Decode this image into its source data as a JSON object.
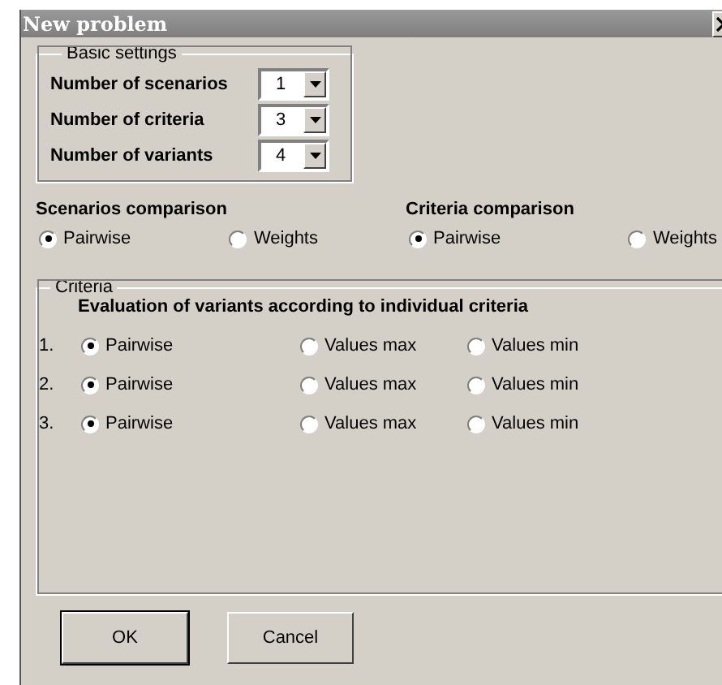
{
  "window": {
    "title": "New problem"
  },
  "basic_settings": {
    "legend": "Basic settings",
    "fields": [
      {
        "label": "Number of scenarios",
        "value": "1"
      },
      {
        "label": "Number of criteria",
        "value": "3"
      },
      {
        "label": "Number of variants",
        "value": "4"
      }
    ]
  },
  "comparisons": [
    {
      "title": "Scenarios comparison",
      "options": [
        {
          "label": "Pairwise",
          "selected": true
        },
        {
          "label": "Weights",
          "selected": false
        }
      ]
    },
    {
      "title": "Criteria comparison",
      "options": [
        {
          "label": "Pairwise",
          "selected": true
        },
        {
          "label": "Weights",
          "selected": false
        }
      ]
    }
  ],
  "criteria": {
    "legend": "Criteria",
    "heading": "Evaluation of variants according to individual criteria",
    "rows": [
      {
        "number": "1.",
        "options": [
          {
            "label": "Pairwise",
            "selected": true
          },
          {
            "label": "Values max",
            "selected": false
          },
          {
            "label": "Values min",
            "selected": false
          }
        ]
      },
      {
        "number": "2.",
        "options": [
          {
            "label": "Pairwise",
            "selected": true
          },
          {
            "label": "Values max",
            "selected": false
          },
          {
            "label": "Values min",
            "selected": false
          }
        ]
      },
      {
        "number": "3.",
        "options": [
          {
            "label": "Pairwise",
            "selected": true
          },
          {
            "label": "Values max",
            "selected": false
          },
          {
            "label": "Values min",
            "selected": false
          }
        ]
      }
    ]
  },
  "buttons": [
    {
      "label": "OK",
      "default": true
    },
    {
      "label": "Cancel",
      "default": false
    }
  ]
}
